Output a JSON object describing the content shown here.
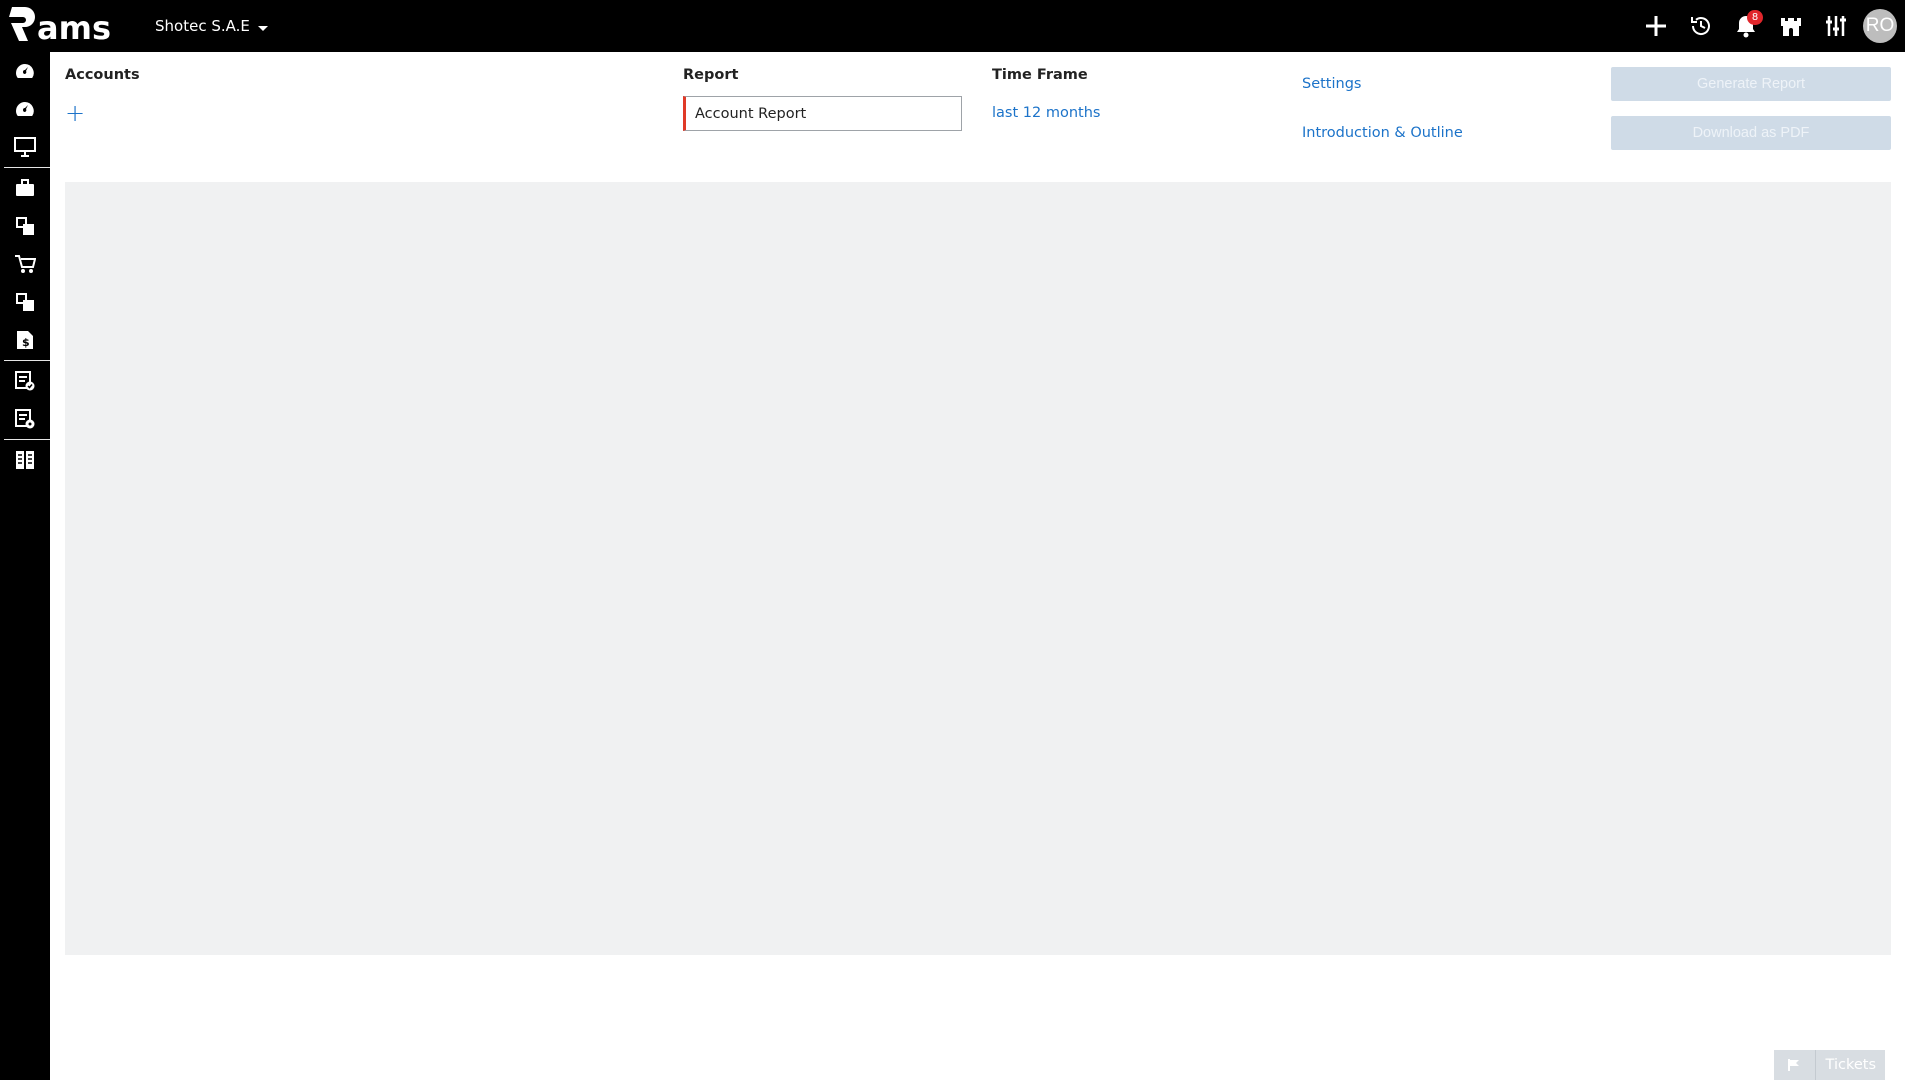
{
  "app": {
    "company": "Shotec S.A.E"
  },
  "topbar": {
    "notification_count": "8",
    "avatar_initials": "RO"
  },
  "columns": {
    "accounts_title": "Accounts",
    "add_account": "+",
    "report_title": "Report",
    "report_value": "Account Report",
    "timeframe_title": "Time Frame",
    "timeframe_value": "last 12 months",
    "settings_link": "Settings",
    "intro_link": "Introduction & Outline"
  },
  "actions": {
    "generate": "Generate Report",
    "download": "Download as PDF"
  },
  "footer": {
    "tickets": "Tickets"
  },
  "colors": {
    "accent": "#1c73c9",
    "input_border_error": "#e03a28",
    "badge": "#e0262b",
    "disabled_button": "#cfdbe7"
  }
}
